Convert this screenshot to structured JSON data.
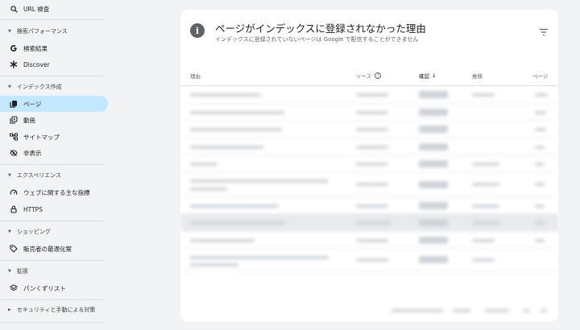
{
  "sidebar": {
    "url_inspection": "URL 検査",
    "performance": {
      "header": "検索パフォーマンス",
      "items": [
        "検索結果",
        "Discover"
      ]
    },
    "indexing": {
      "header": "インデックス作成",
      "items": [
        "ページ",
        "動画",
        "サイトマップ",
        "非表示"
      ]
    },
    "experience": {
      "header": "エクスペリエンス",
      "items": [
        "ウェブに関する主な指標",
        "HTTPS"
      ]
    },
    "shopping": {
      "header": "ショッピング",
      "items": [
        "販売者の最適化案"
      ]
    },
    "enhancements": {
      "header": "拡張",
      "items": [
        "パンくずリスト"
      ]
    },
    "security": {
      "header": "セキュリティと手動による対策"
    }
  },
  "card": {
    "title": "ページがインデックスに登録されなかった理由",
    "subtitle": "インデックスに登録されていないページは Google で配信することができません",
    "columns": {
      "reason": "理由",
      "source": "ソース",
      "validation": "確認",
      "trend": "推移",
      "pages": "ページ"
    }
  },
  "colors": {
    "active_bg": "#c2e7ff",
    "page_bg": "#f1f3f4",
    "card_bg": "#ffffff",
    "row_highlight": "#e8eaed"
  }
}
